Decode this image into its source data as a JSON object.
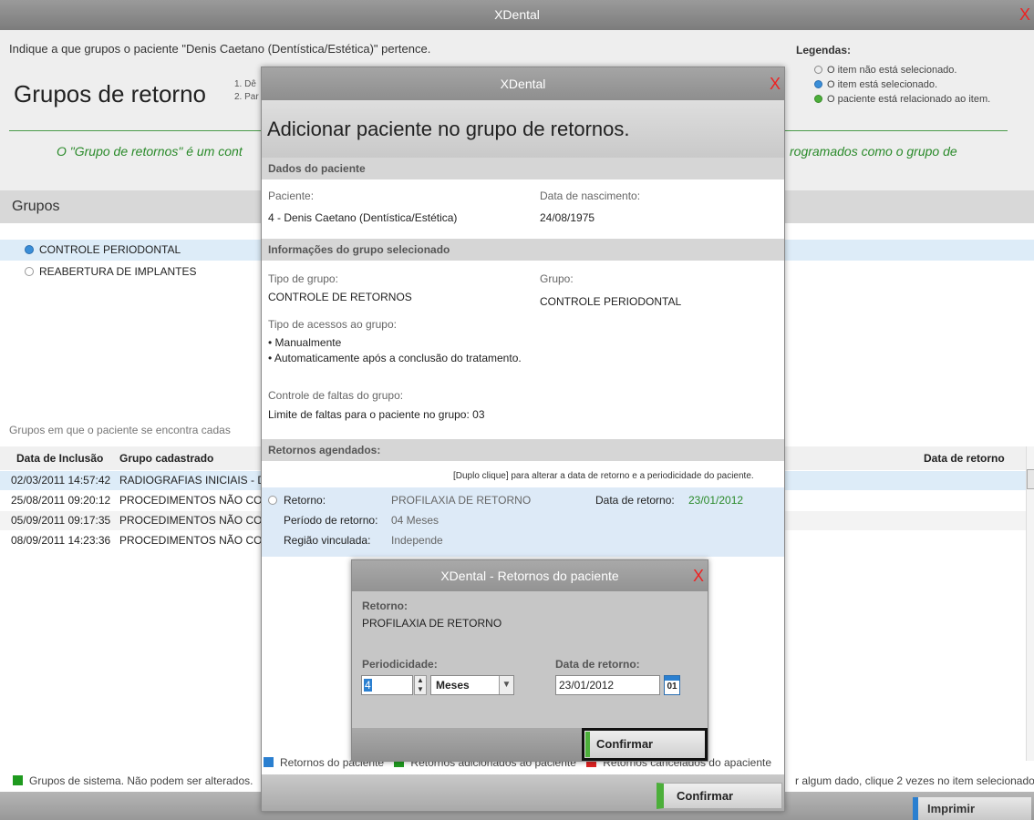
{
  "main": {
    "title": "XDental",
    "close": "X",
    "indicate_text": "Indique a que grupos o paciente \"Denis Caetano (Dentística/Estética)\" pertence.",
    "page_title": "Grupos de retorno",
    "instructions": [
      "1. Dê",
      "2. Par"
    ],
    "green_text_left": "O \"Grupo de retornos\" é um cont",
    "green_text_right": "rogramados como o grupo de",
    "legend": {
      "title": "Legendas:",
      "items": [
        "O item não está selecionado.",
        "O item está selecionado.",
        "O paciente está relacionado ao item."
      ]
    },
    "groups_header": "Grupos",
    "groups": [
      {
        "label": "CONTROLE PERIODONTAL",
        "selected": true
      },
      {
        "label": "REABERTURA DE IMPLANTES",
        "selected": false
      }
    ],
    "cadastrado_label": "Grupos em que o paciente se encontra cadas",
    "table": {
      "headers": [
        "Data de Inclusão",
        "Grupo cadastrado",
        "Data de retorno"
      ],
      "rows": [
        {
          "date": "02/03/2011 14:57:42",
          "group": "RADIOGRAFIAS INICIAIS - Dr"
        },
        {
          "date": "25/08/2011 09:20:12",
          "group": "PROCEDIMENTOS NÃO CONC"
        },
        {
          "date": "05/09/2011 09:17:35",
          "group": "PROCEDIMENTOS NÃO CONC"
        },
        {
          "date": "08/09/2011 14:23:36",
          "group": "PROCEDIMENTOS NÃO CONC"
        }
      ]
    },
    "system_note": "Grupos de sistema. Não podem ser alterados.",
    "alter_note": "r algum dado, clique 2 vezes no item selecionado.",
    "print_button": "Imprimir"
  },
  "modal1": {
    "title": "XDental",
    "close": "X",
    "heading": "Adicionar paciente no grupo de retornos.",
    "section_patient": "Dados do paciente",
    "patient_label": "Paciente:",
    "patient_value": "4 - Denis Caetano (Dentística/Estética)",
    "birth_label": "Data de nascimento:",
    "birth_value": "24/08/1975",
    "section_group": "Informações do grupo selecionado",
    "group_type_label": "Tipo de grupo:",
    "group_type_value": "CONTROLE DE RETORNOS",
    "group_label": "Grupo:",
    "group_value": "CONTROLE PERIODONTAL",
    "access_label": "Tipo de acessos ao grupo:",
    "access_items": [
      "• Manualmente",
      "• Automaticamente após a conclusão do tratamento."
    ],
    "faltas_label": "Controle de faltas do grupo:",
    "faltas_value": "Limite de faltas para o paciente no grupo: 03",
    "section_returns": "Retornos agendados:",
    "hint": "[Duplo clique] para alterar a data de retorno e a periodicidade do paciente.",
    "return": {
      "retorno_label": "Retorno:",
      "retorno_value": "PROFILAXIA DE RETORNO",
      "data_label": "Data de retorno:",
      "data_value": "23/01/2012",
      "periodo_label": "Período de retorno:",
      "periodo_value": "04 Meses",
      "regiao_label": "Região vinculada:",
      "regiao_value": "Independe"
    },
    "legend": [
      "Retornos do paciente",
      "Retornos adicionados ao paciente",
      "Retornos cancelados do apaciente"
    ],
    "confirm": "Confirmar",
    "colors": {
      "blue": "#2a7fd0",
      "green": "#1f9a1f",
      "red": "#dd2222"
    }
  },
  "modal2": {
    "title": "XDental - Retornos do paciente",
    "close": "X",
    "retorno_label": "Retorno:",
    "retorno_value": "PROFILAXIA DE RETORNO",
    "periodicidade_label": "Periodicidade:",
    "periodicidade_value": "4",
    "unit_value": "Meses",
    "data_label": "Data de retorno:",
    "data_value": "23/01/2012",
    "calendar_day": "01",
    "confirm": "Confirmar"
  }
}
